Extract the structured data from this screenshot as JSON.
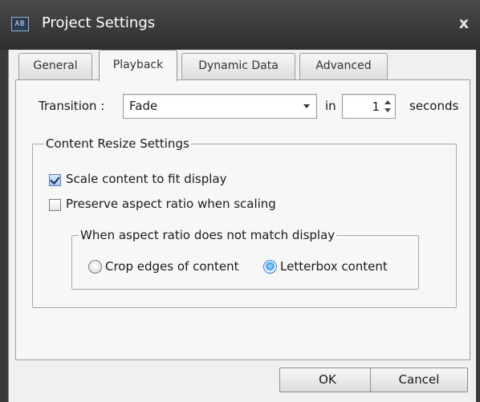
{
  "window": {
    "title": "Project Settings",
    "app_icon_text": "AB",
    "close_glyph": "x"
  },
  "tabs": [
    {
      "label": "General",
      "active": false
    },
    {
      "label": "Playback",
      "active": true
    },
    {
      "label": "Dynamic Data",
      "active": false
    },
    {
      "label": "Advanced",
      "active": false
    }
  ],
  "playback": {
    "transition_label": "Transition :",
    "transition_value": "Fade",
    "in_label": "in",
    "duration_value": "1",
    "seconds_label": "seconds",
    "resize_group": {
      "title": "Content Resize Settings",
      "scale_label": "Scale content to fit display",
      "scale_checked": true,
      "preserve_label": "Preserve aspect ratio when scaling",
      "preserve_checked": false,
      "mismatch_group": {
        "title": "When aspect ratio does not match display",
        "crop_label": "Crop edges of content",
        "crop_selected": false,
        "letterbox_label": "Letterbox content",
        "letterbox_selected": true
      }
    }
  },
  "buttons": {
    "ok": "OK",
    "cancel": "Cancel"
  },
  "icons": {
    "app": "app-icon",
    "close": "close-icon",
    "dropdown": "chevron-down-icon",
    "spin_up": "spin-up-icon",
    "spin_down": "spin-down-icon"
  },
  "colors": {
    "titlebar": "#3a3a3a",
    "dialog_background": "#f0f0f0",
    "radio_accent": "#3c9be8"
  }
}
